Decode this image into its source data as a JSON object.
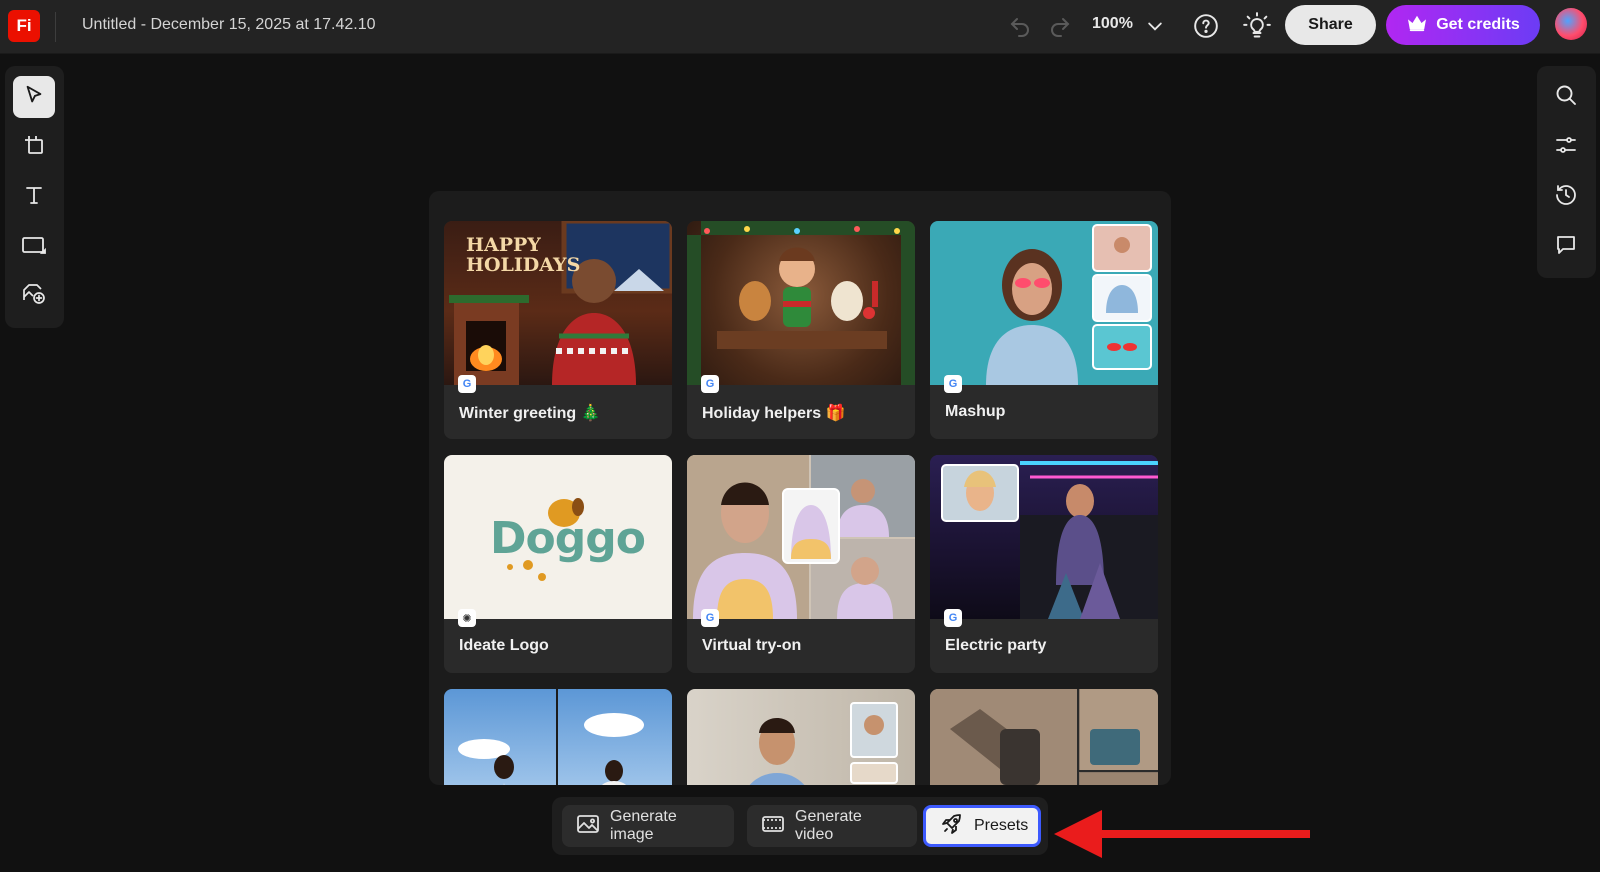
{
  "app": {
    "logo_text": "Fi",
    "document_title": "Untitled - December 15, 2025 at 17.42.10"
  },
  "header": {
    "zoom_label": "100%",
    "share_label": "Share",
    "credits_label": "Get credits",
    "icons": [
      "undo-icon",
      "redo-icon",
      "chevron-down-icon",
      "help-icon",
      "lightbulb-icon",
      "crown-icon",
      "avatar"
    ]
  },
  "left_toolbar": [
    "select-tool",
    "artboard-tool",
    "text-tool",
    "shape-tool",
    "add-image-tool"
  ],
  "right_toolbar": [
    "search-icon",
    "adjustments-icon",
    "history-icon",
    "comment-icon"
  ],
  "presets": [
    {
      "label": "Winter greeting 🎄",
      "badge": "G"
    },
    {
      "label": "Holiday helpers 🎁",
      "badge": "G"
    },
    {
      "label": "Mashup",
      "badge": "G"
    },
    {
      "label": "Ideate Logo",
      "badge": "✺"
    },
    {
      "label": "Virtual try-on",
      "badge": "G"
    },
    {
      "label": "Electric party",
      "badge": "G"
    }
  ],
  "thumb_text": {
    "happy": "HAPPY",
    "holidays": "HOLIDAYS",
    "doggo": "Doggo"
  },
  "bottom_bar": {
    "generate_image": "Generate image",
    "generate_video": "Generate video",
    "presets": "Presets"
  },
  "colors": {
    "accent": "#3d5afe",
    "credits_start": "#b127f2",
    "credits_end": "#6c3cf5",
    "arrow": "#ea1c1c",
    "logo": "#eb1000"
  }
}
